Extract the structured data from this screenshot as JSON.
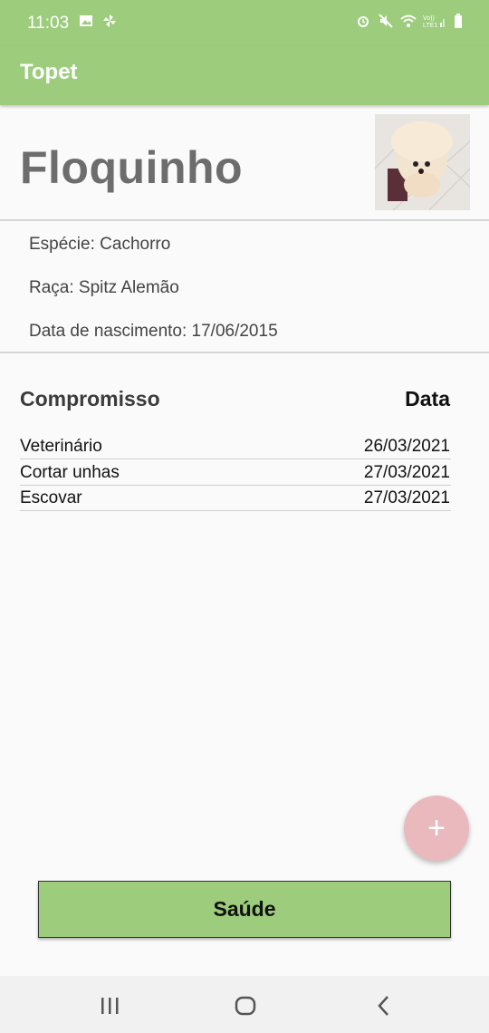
{
  "status_bar": {
    "time": "11:03",
    "icons_left": [
      "image-icon",
      "pinwheel-icon"
    ],
    "icons_right": [
      "alarm-icon",
      "mute-icon",
      "wifi-icon",
      "lte-signal-icon",
      "battery-icon"
    ],
    "network_label": "Vo)) LTE1"
  },
  "app_bar": {
    "title": "Topet"
  },
  "pet": {
    "name": "Floquinho",
    "species": "Espécie: Cachorro",
    "breed": "Raça: Spitz Alemão",
    "birth": "Data de nascimento: 17/06/2015"
  },
  "schedule": {
    "header_task": "Compromisso",
    "header_date": "Data",
    "rows": [
      {
        "task": "Veterinário",
        "date": "26/03/2021"
      },
      {
        "task": "Cortar unhas",
        "date": "27/03/2021"
      },
      {
        "task": "Escovar",
        "date": "27/03/2021"
      }
    ]
  },
  "fab": {
    "icon": "plus-icon",
    "label": "+"
  },
  "health_button": {
    "label": "Saúde"
  },
  "nav": {
    "items": [
      "recents-icon",
      "home-icon",
      "back-icon"
    ]
  },
  "colors": {
    "primary": "#9ccc7c",
    "fab": "#e9b9be",
    "background": "#fafafa"
  }
}
